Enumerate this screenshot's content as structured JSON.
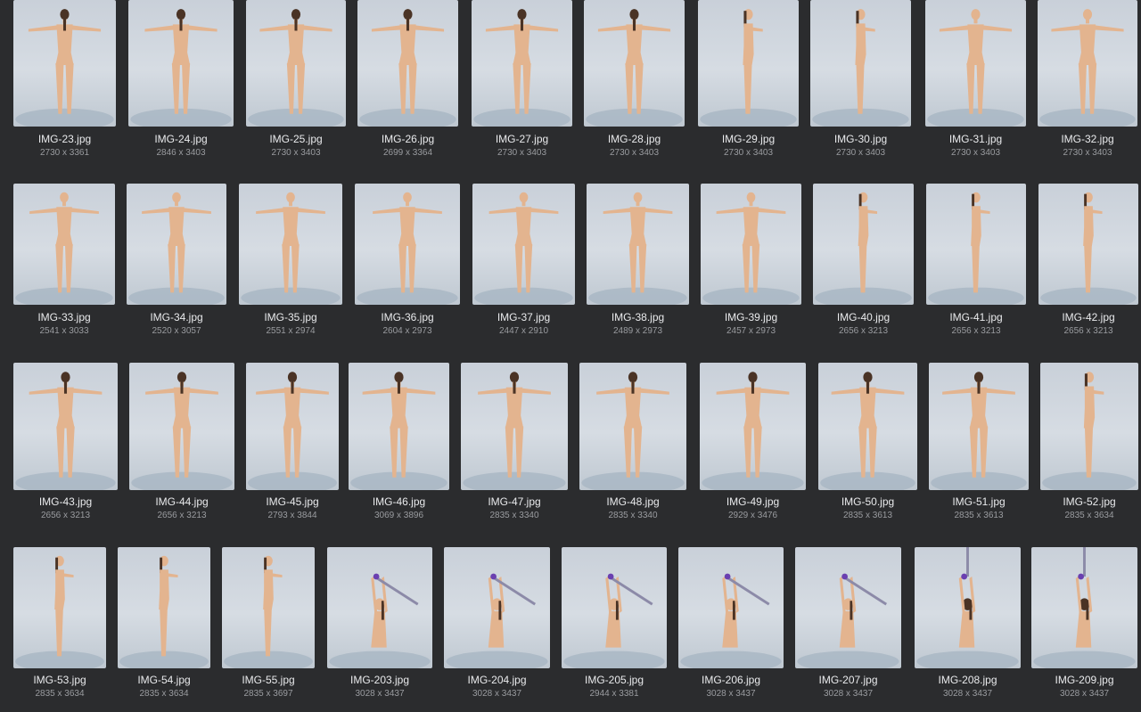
{
  "gallery": {
    "items": [
      {
        "name": "IMG-23.jpg",
        "dims": "2730 x 3361",
        "pose": "back-t"
      },
      {
        "name": "IMG-24.jpg",
        "dims": "2846 x 3403",
        "pose": "back-t"
      },
      {
        "name": "IMG-25.jpg",
        "dims": "2730 x 3403",
        "pose": "back-t"
      },
      {
        "name": "IMG-26.jpg",
        "dims": "2699 x 3364",
        "pose": "back-t"
      },
      {
        "name": "IMG-27.jpg",
        "dims": "2730 x 3403",
        "pose": "back-t"
      },
      {
        "name": "IMG-28.jpg",
        "dims": "2730 x 3403",
        "pose": "back-t"
      },
      {
        "name": "IMG-29.jpg",
        "dims": "2730 x 3403",
        "pose": "side"
      },
      {
        "name": "IMG-30.jpg",
        "dims": "2730 x 3403",
        "pose": "side"
      },
      {
        "name": "IMG-31.jpg",
        "dims": "2730 x 3403",
        "pose": "front-t"
      },
      {
        "name": "IMG-32.jpg",
        "dims": "2730 x 3403",
        "pose": "front-t"
      },
      {
        "name": "IMG-33.jpg",
        "dims": "2541 x 3033",
        "pose": "front-t"
      },
      {
        "name": "IMG-34.jpg",
        "dims": "2520 x 3057",
        "pose": "front-t"
      },
      {
        "name": "IMG-35.jpg",
        "dims": "2551 x 2974",
        "pose": "front-t"
      },
      {
        "name": "IMG-36.jpg",
        "dims": "2604 x 2973",
        "pose": "front-t"
      },
      {
        "name": "IMG-37.jpg",
        "dims": "2447 x 2910",
        "pose": "front-t"
      },
      {
        "name": "IMG-38.jpg",
        "dims": "2489 x 2973",
        "pose": "front-t"
      },
      {
        "name": "IMG-39.jpg",
        "dims": "2457 x 2973",
        "pose": "front-t"
      },
      {
        "name": "IMG-40.jpg",
        "dims": "2656 x 3213",
        "pose": "side"
      },
      {
        "name": "IMG-41.jpg",
        "dims": "2656 x 3213",
        "pose": "side"
      },
      {
        "name": "IMG-42.jpg",
        "dims": "2656 x 3213",
        "pose": "side"
      },
      {
        "name": "IMG-43.jpg",
        "dims": "2656 x 3213",
        "pose": "back-t"
      },
      {
        "name": "IMG-44.jpg",
        "dims": "2656 x 3213",
        "pose": "back-t"
      },
      {
        "name": "IMG-45.jpg",
        "dims": "2793 x 3844",
        "pose": "back-t"
      },
      {
        "name": "IMG-46.jpg",
        "dims": "3069 x 3896",
        "pose": "back-t"
      },
      {
        "name": "IMG-47.jpg",
        "dims": "2835 x 3340",
        "pose": "back-t"
      },
      {
        "name": "IMG-48.jpg",
        "dims": "2835 x 3340",
        "pose": "back-t"
      },
      {
        "name": "IMG-49.jpg",
        "dims": "2929 x 3476",
        "pose": "back-t"
      },
      {
        "name": "IMG-50.jpg",
        "dims": "2835 x 3613",
        "pose": "back-t"
      },
      {
        "name": "IMG-51.jpg",
        "dims": "2835 x 3613",
        "pose": "back-t"
      },
      {
        "name": "IMG-52.jpg",
        "dims": "2835 x 3634",
        "pose": "side"
      },
      {
        "name": "IMG-53.jpg",
        "dims": "2835 x 3634",
        "pose": "side"
      },
      {
        "name": "IMG-54.jpg",
        "dims": "2835 x 3634",
        "pose": "side"
      },
      {
        "name": "IMG-55.jpg",
        "dims": "2835 x 3697",
        "pose": "side"
      },
      {
        "name": "IMG-203.jpg",
        "dims": "3028 x 3437",
        "pose": "kneel-sword"
      },
      {
        "name": "IMG-204.jpg",
        "dims": "3028 x 3437",
        "pose": "kneel-sword"
      },
      {
        "name": "IMG-205.jpg",
        "dims": "2944 x 3381",
        "pose": "kneel-sword"
      },
      {
        "name": "IMG-206.jpg",
        "dims": "3028 x 3437",
        "pose": "kneel-sword"
      },
      {
        "name": "IMG-207.jpg",
        "dims": "3028 x 3437",
        "pose": "kneel-sword"
      },
      {
        "name": "IMG-208.jpg",
        "dims": "3028 x 3437",
        "pose": "kneel-sword-back"
      },
      {
        "name": "IMG-209.jpg",
        "dims": "3028 x 3437",
        "pose": "kneel-sword-back"
      }
    ]
  },
  "colors": {
    "background": "#2b2c2e",
    "photo_backdrop": "#d3d9e1",
    "skin": "#e3b48f",
    "hair": "#4a3325",
    "pedestal": "#a9b7c4",
    "blade": "#8c8aa8",
    "hilt": "#6a3fb0"
  }
}
